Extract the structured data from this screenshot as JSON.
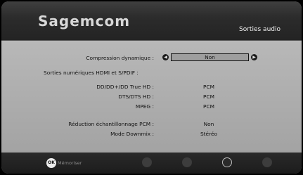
{
  "header": {
    "brand": "Sagemcom",
    "title": "Sorties audio"
  },
  "settings": {
    "compression_label": "Compression dynamique :",
    "compression_value": "Non",
    "digital_outputs_label": "Sorties numériques HDMI et S/PDIF :",
    "dd_label": "DD/DD+/DD True HD :",
    "dd_value": "PCM",
    "dts_label": "DTS/DTS HD :",
    "dts_value": "PCM",
    "mpeg_label": "MPEG :",
    "mpeg_value": "PCM",
    "resampling_label": "Réduction échantillonnage PCM :",
    "resampling_value": "Non",
    "downmix_label": "Mode Downmix :",
    "downmix_value": "Stéréo"
  },
  "footer": {
    "ok_icon_text": "OK",
    "ok_label": "Mémoriser"
  },
  "colors": {
    "header_bg": "#2c2c2c",
    "content_bg": "#aeaeae",
    "footer_bg": "#1f1f1f"
  }
}
